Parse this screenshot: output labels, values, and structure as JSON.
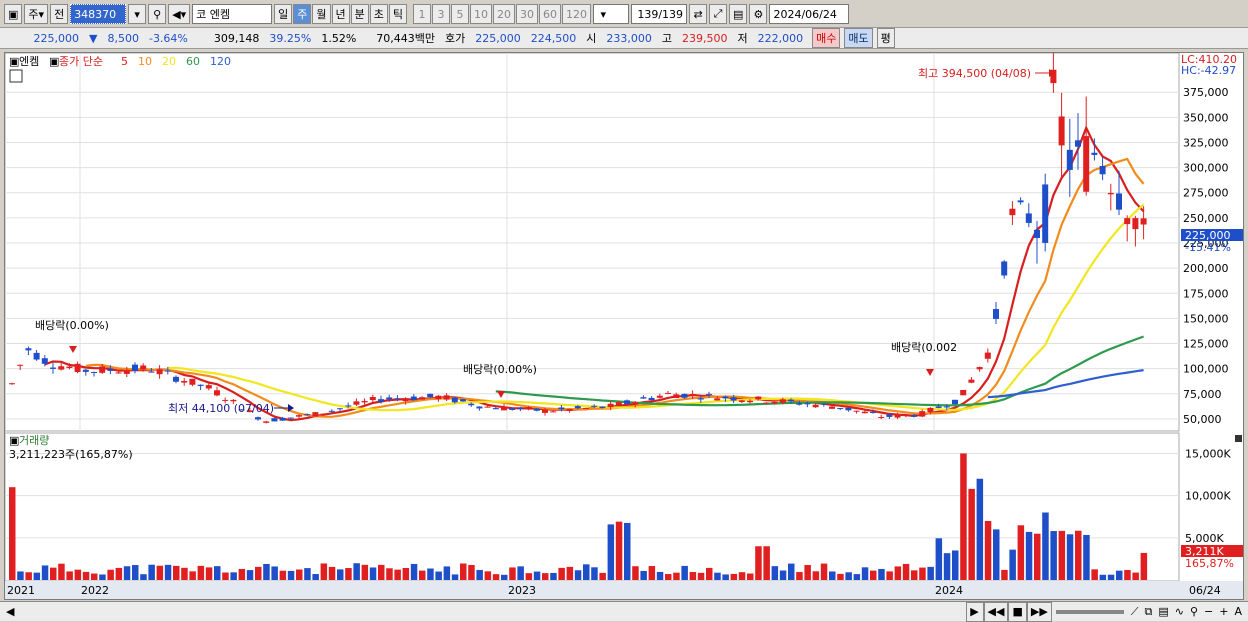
{
  "toolbar": {
    "market": "주",
    "prev_label": "전",
    "code": "348370",
    "stock_name": "엔켐",
    "stock_prefix": "코",
    "periods": [
      "일",
      "주",
      "월",
      "년",
      "분",
      "초",
      "틱"
    ],
    "selected_period": "주",
    "intervals": [
      "1",
      "3",
      "5",
      "10",
      "20",
      "30",
      "60",
      "120"
    ],
    "count": "139/139",
    "date": "2024/06/24"
  },
  "quote": {
    "price": "225,000",
    "change": "8,500",
    "change_pct": "-3.64%",
    "volume": "309,148",
    "vol_ratio": "39.25%",
    "turnover": "1.52%",
    "amount": "70,443백만",
    "ask_label": "호가",
    "ask1": "225,000",
    "ask2": "224,500",
    "open_label": "시",
    "open": "233,000",
    "high_label": "고",
    "high": "239,500",
    "low_label": "저",
    "low": "222,000",
    "buy_label": "매수",
    "sell_label": "매도",
    "pyeong_label": "평"
  },
  "price_panel": {
    "legend_stock": "엔켐",
    "legend_ma": "종가 단순",
    "ma_periods": [
      "5",
      "10",
      "20",
      "60",
      "120"
    ],
    "ma_colors": [
      "#d81e1e",
      "#f08c1e",
      "#f2e61e",
      "#2e9a4e",
      "#2e5fd0"
    ],
    "lc": "LC:410.20",
    "hc": "HC:-42.97",
    "y_ticks": [
      "375,000",
      "350,000",
      "325,000",
      "300,000",
      "275,000",
      "250,000",
      "225,000",
      "200,000",
      "175,000",
      "150,000",
      "125,000",
      "100,000",
      "75,000",
      "50,000"
    ],
    "current_price_label": "225,000",
    "current_pct_label": "-15.41%",
    "high_annotation": "최고 394,500 (04/08)",
    "low_annotation": "최저 44,100 (07/04)",
    "dividend_labels": [
      "배당락(0.00%)",
      "배당락(0.00%)",
      "배당락(0.002"
    ]
  },
  "volume_panel": {
    "title": "거래량",
    "summary": "3,211,223주(165,87%)",
    "y_ticks": [
      "15,000K",
      "10,000K",
      "5,000K"
    ],
    "current_label": "3,211K",
    "current_pct": "165,87%"
  },
  "x_axis": {
    "labels": [
      "2021",
      "2022",
      "2023",
      "2024",
      "06/24"
    ]
  },
  "colors": {
    "up": "#e02020",
    "down": "#1f4fc8",
    "bg": "#ffffff",
    "grid": "#e0e0e0",
    "accent": "#3366cc"
  },
  "chart_data": {
    "type": "candlestick",
    "ylim": [
      40000,
      410000
    ],
    "highest": {
      "value": 394500,
      "date": "04/08"
    },
    "lowest": {
      "value": 44100,
      "date": "07/04"
    },
    "last_close": 225000,
    "volume_ylim": [
      0,
      16000
    ],
    "last_volume_k": 3211
  }
}
